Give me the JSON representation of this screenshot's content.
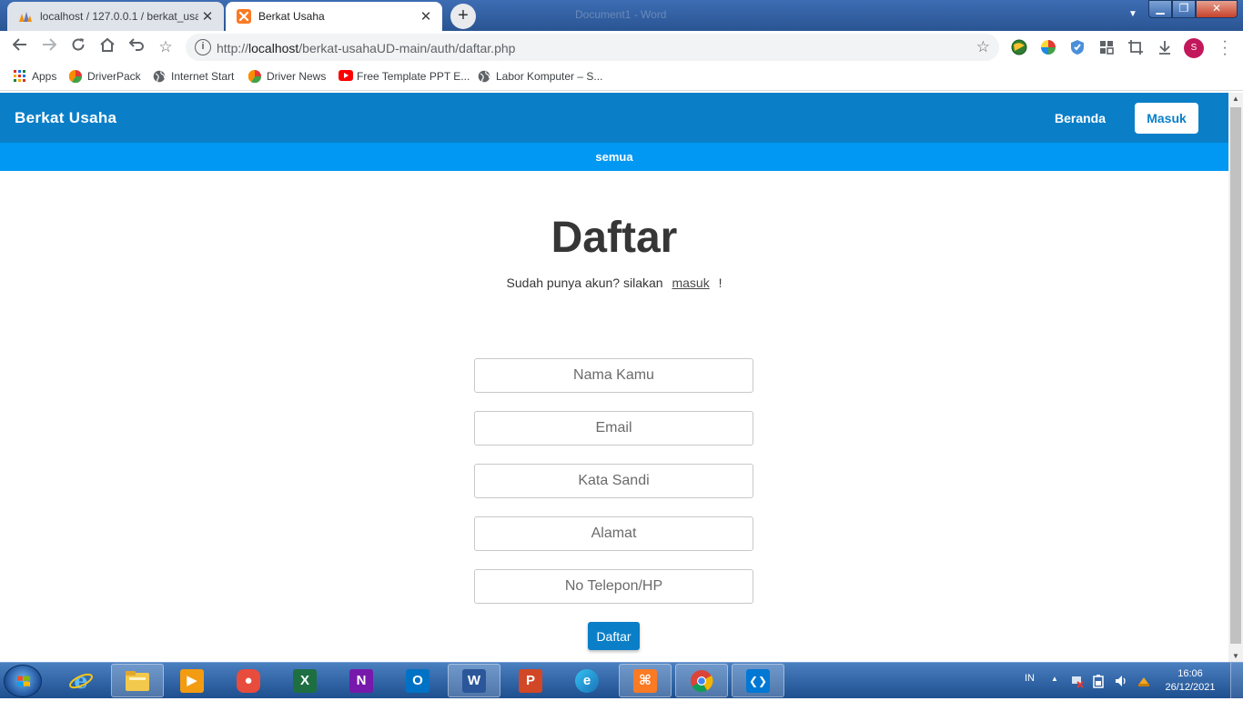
{
  "browser": {
    "tabs": [
      {
        "title": "localhost / 127.0.0.1 / berkat_usa",
        "active": false,
        "icon": "phpmyadmin-icon"
      },
      {
        "title": "Berkat Usaha",
        "active": true,
        "icon": "xampp-icon"
      }
    ],
    "new_tab": "+",
    "close_glyph": "✕",
    "window_title": "Document1 - Word",
    "window_controls": {
      "minimize": "▁",
      "maximize": "❐",
      "close": "✕"
    },
    "url": {
      "scheme": "http://",
      "host": "localhost",
      "path": "/berkat-usahaUD-main/auth/daftar.php"
    },
    "profile_initial": "S",
    "bookmarks": [
      {
        "label": "Apps",
        "icon": "apps-grid-icon"
      },
      {
        "label": "DriverPack",
        "icon": "driverpack-icon"
      },
      {
        "label": "Internet Start",
        "icon": "globe-icon"
      },
      {
        "label": "Driver News",
        "icon": "driverpack-icon"
      },
      {
        "label": "Free Template PPT E...",
        "icon": "youtube-icon"
      },
      {
        "label": "Labor Komputer – S...",
        "icon": "globe-icon"
      }
    ]
  },
  "site": {
    "brand": "Berkat Usaha",
    "nav": {
      "home": "Beranda",
      "login": "Masuk"
    },
    "category": "semua",
    "colors": {
      "primary": "#0a7fc8",
      "category_bar": "#0098f2"
    }
  },
  "form": {
    "heading": "Daftar",
    "subtext_before": "Sudah punya akun? silakan",
    "subtext_link": "masuk",
    "subtext_after": "!",
    "fields": {
      "name": "Nama Kamu",
      "email": "Email",
      "password": "Kata Sandi",
      "address": "Alamat",
      "phone": "No Telepon/HP"
    },
    "submit": "Daftar"
  },
  "taskbar": {
    "apps": [
      {
        "name": "file-explorer-icon",
        "glyph": ""
      },
      {
        "name": "media-player-icon",
        "glyph": "▶"
      },
      {
        "name": "camera-app-icon",
        "glyph": "●"
      },
      {
        "name": "excel-icon",
        "glyph": "X"
      },
      {
        "name": "onenote-icon",
        "glyph": "N"
      },
      {
        "name": "outlook-icon",
        "glyph": "O"
      },
      {
        "name": "word-icon",
        "glyph": "W"
      },
      {
        "name": "powerpoint-icon",
        "glyph": "P"
      },
      {
        "name": "edge-icon",
        "glyph": "e"
      },
      {
        "name": "xampp-icon",
        "glyph": "⌘"
      },
      {
        "name": "chrome-icon",
        "glyph": ""
      },
      {
        "name": "vscode-icon",
        "glyph": "❮❯"
      }
    ],
    "language": "IN",
    "time": "16:06",
    "date": "26/12/2021"
  }
}
